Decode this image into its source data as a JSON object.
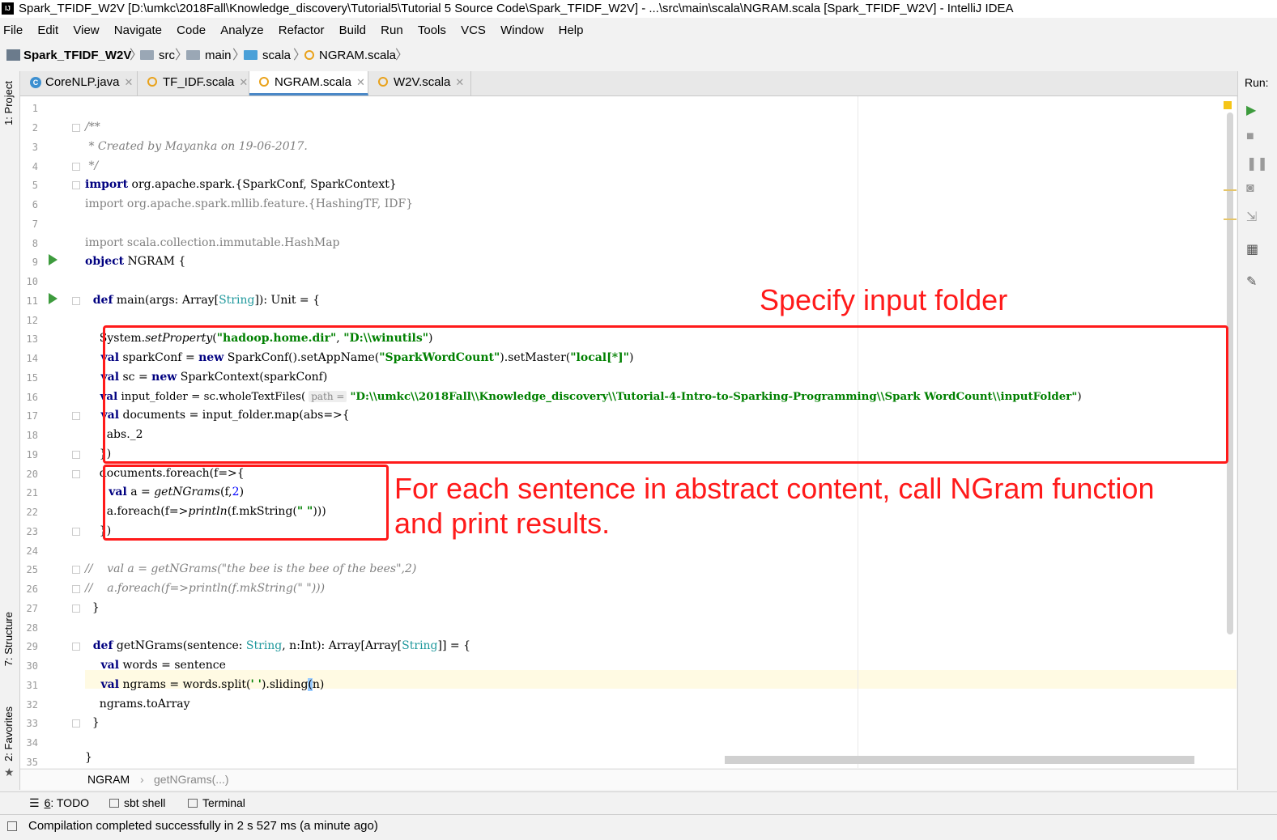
{
  "window": {
    "title": "Spark_TFIDF_W2V [D:\\umkc\\2018Fall\\Knowledge_discovery\\Tutorial5\\Tutorial 5 Source Code\\Spark_TFIDF_W2V] - ...\\src\\main\\scala\\NGRAM.scala [Spark_TFIDF_W2V] - IntelliJ IDEA",
    "app_icon_text": "IJ"
  },
  "menu": [
    "File",
    "Edit",
    "View",
    "Navigate",
    "Code",
    "Analyze",
    "Refactor",
    "Build",
    "Run",
    "Tools",
    "VCS",
    "Window",
    "Help"
  ],
  "navbar": {
    "project": "Spark_TFIDF_W2V",
    "crumbs": [
      "src",
      "main",
      "scala",
      "NGRAM.scala"
    ]
  },
  "side_tabs": {
    "project": "1: Project",
    "structure": "7: Structure",
    "favorites": "2: Favorites"
  },
  "run_panel": {
    "label": "Run:"
  },
  "tabs": [
    {
      "label": "CoreNLP.java",
      "kind": "java",
      "active": false
    },
    {
      "label": "TF_IDF.scala",
      "kind": "scala",
      "active": false
    },
    {
      "label": "NGRAM.scala",
      "kind": "scala",
      "active": true
    },
    {
      "label": "W2V.scala",
      "kind": "scala",
      "active": false
    }
  ],
  "editor": {
    "line_numbers": [
      "1",
      "2",
      "3",
      "4",
      "5",
      "6",
      "7",
      "8",
      "9",
      "10",
      "11",
      "12",
      "13",
      "14",
      "15",
      "16",
      "17",
      "18",
      "19",
      "20",
      "21",
      "22",
      "23",
      "24",
      "25",
      "26",
      "27",
      "28",
      "29",
      "30",
      "31",
      "32",
      "33",
      "34",
      "35"
    ],
    "l2": "/**",
    "l3": " * Created by Mayanka on 19-06-2017.",
    "l4": " */",
    "l5_kw": "import",
    "l5_rest": " org.apache.spark.{SparkConf, SparkContext}",
    "l6_kw": "import",
    "l6_rest": " org.apache.spark.mllib.feature.{HashingTF, IDF}",
    "l8_kw": "import",
    "l8_rest": " scala.collection.immutable.HashMap",
    "l9_kw": "object",
    "l9_rest": " NGRAM {",
    "l11_kw": "  def",
    "l11_a": " main(args: Array[",
    "l11_type": "String",
    "l11_b": "]): Unit = {",
    "l13_a": "    System.",
    "l13_m": "setProperty",
    "l13_b": "(",
    "l13_s1": "\"hadoop.home.dir\"",
    "l13_c": ", ",
    "l13_s2": "\"D:\\\\winutils\"",
    "l13_d": ")",
    "l14_kw": "    val",
    "l14_a": " sparkConf = ",
    "l14_kw2": "new",
    "l14_b": " SparkConf().setAppName(",
    "l14_s1": "\"SparkWordCount\"",
    "l14_c": ").setMaster(",
    "l14_s2": "\"local[*]\"",
    "l14_d": ")",
    "l15_kw": "    val",
    "l15_a": " sc = ",
    "l15_kw2": "new",
    "l15_b": " SparkContext(sparkConf)",
    "l16_kw": "    val",
    "l16_a": " input_folder = sc.wholeTextFiles(",
    "l16_hint": "path =",
    "l16_s": "\"D:\\\\umkc\\\\2018Fall\\\\Knowledge_discovery\\\\Tutorial-4-Intro-to-Sparking-Programming\\\\Spark WordCount\\\\inputFolder\"",
    "l16_b": ")",
    "l17_kw": "    val",
    "l17_a": " documents = input_folder.map(abs=>{",
    "l18": "      abs._2",
    "l19": "    })",
    "l20": "    documents.foreach(f=>{",
    "l21_kw": "      val",
    "l21_a": " a = ",
    "l21_m": "getNGrams",
    "l21_b": "(f,",
    "l21_n": "2",
    "l21_c": ")",
    "l22_a": "      a.foreach(f=>",
    "l22_m": "println",
    "l22_b": "(f.mkString(",
    "l22_s": "\" \"",
    "l22_c": ")))",
    "l23": "    })",
    "l25": "//    val a = getNGrams(\"the bee is the bee of the bees\",2)",
    "l26": "//    a.foreach(f=>println(f.mkString(\" \")))",
    "l27": "  }",
    "l29_kw": "  def",
    "l29_a": " getNGrams(sentence: ",
    "l29_t1": "String",
    "l29_b": ", n:Int): Array[Array[",
    "l29_t2": "String",
    "l29_c": "]] = {",
    "l30_kw": "    val",
    "l30_a": " words = sentence",
    "l31_kw": "    val",
    "l31_a": " ngrams = words.split(",
    "l31_s": "' '",
    "l31_b": ").sliding",
    "l31_c": "(",
    "l31_d": "n)",
    "l32": "    ngrams.toArray",
    "l33": "  }",
    "l35": "}"
  },
  "annotations": {
    "input_folder": "Specify input folder",
    "ngram_line1": "For each sentence in abstract content, call NGram function",
    "ngram_line2": "and print results."
  },
  "code_breadcrumb": {
    "object": "NGRAM",
    "method": "getNGrams(...)"
  },
  "tool_windows": {
    "todo_num": "6",
    "todo": ": TODO",
    "sbt": "sbt shell",
    "terminal": "Terminal"
  },
  "status": "Compilation completed successfully in 2 s 527 ms (a minute ago)",
  "colors": {
    "annotation": "#ff1a1a",
    "keyword": "#000080",
    "string": "#008000"
  }
}
